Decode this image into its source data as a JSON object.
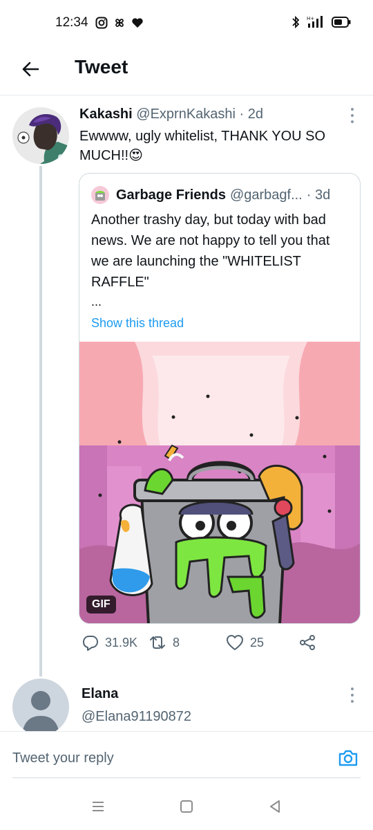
{
  "status_bar": {
    "time": "12:34"
  },
  "header": {
    "title": "Tweet"
  },
  "tweet": {
    "author_name": "Kakashi",
    "author_handle": "@ExprnKakashi",
    "time": "· 2d",
    "text": "Ewwww, ugly whitelist, THANK YOU SO MUCH!!",
    "emoji": "😍"
  },
  "quote": {
    "author_name": "Garbage Friends",
    "author_handle": "@garbagf...",
    "time": "· 3d",
    "text": "Another trashy day, but today with bad news. We are not happy to tell you that we are launching the \"WHITELIST RAFFLE\"",
    "ellipsis": "...",
    "show_thread": "Show this thread",
    "media_badge": "GIF"
  },
  "actions": {
    "replies": "31.9K",
    "retweets": "8",
    "likes": "25"
  },
  "reply_author": {
    "name": "Elana",
    "handle": "@Elana91190872"
  },
  "composer": {
    "placeholder": "Tweet your reply"
  },
  "colors": {
    "accent": "#1d9bf0",
    "muted": "#536471",
    "line": "#cfd9de"
  }
}
